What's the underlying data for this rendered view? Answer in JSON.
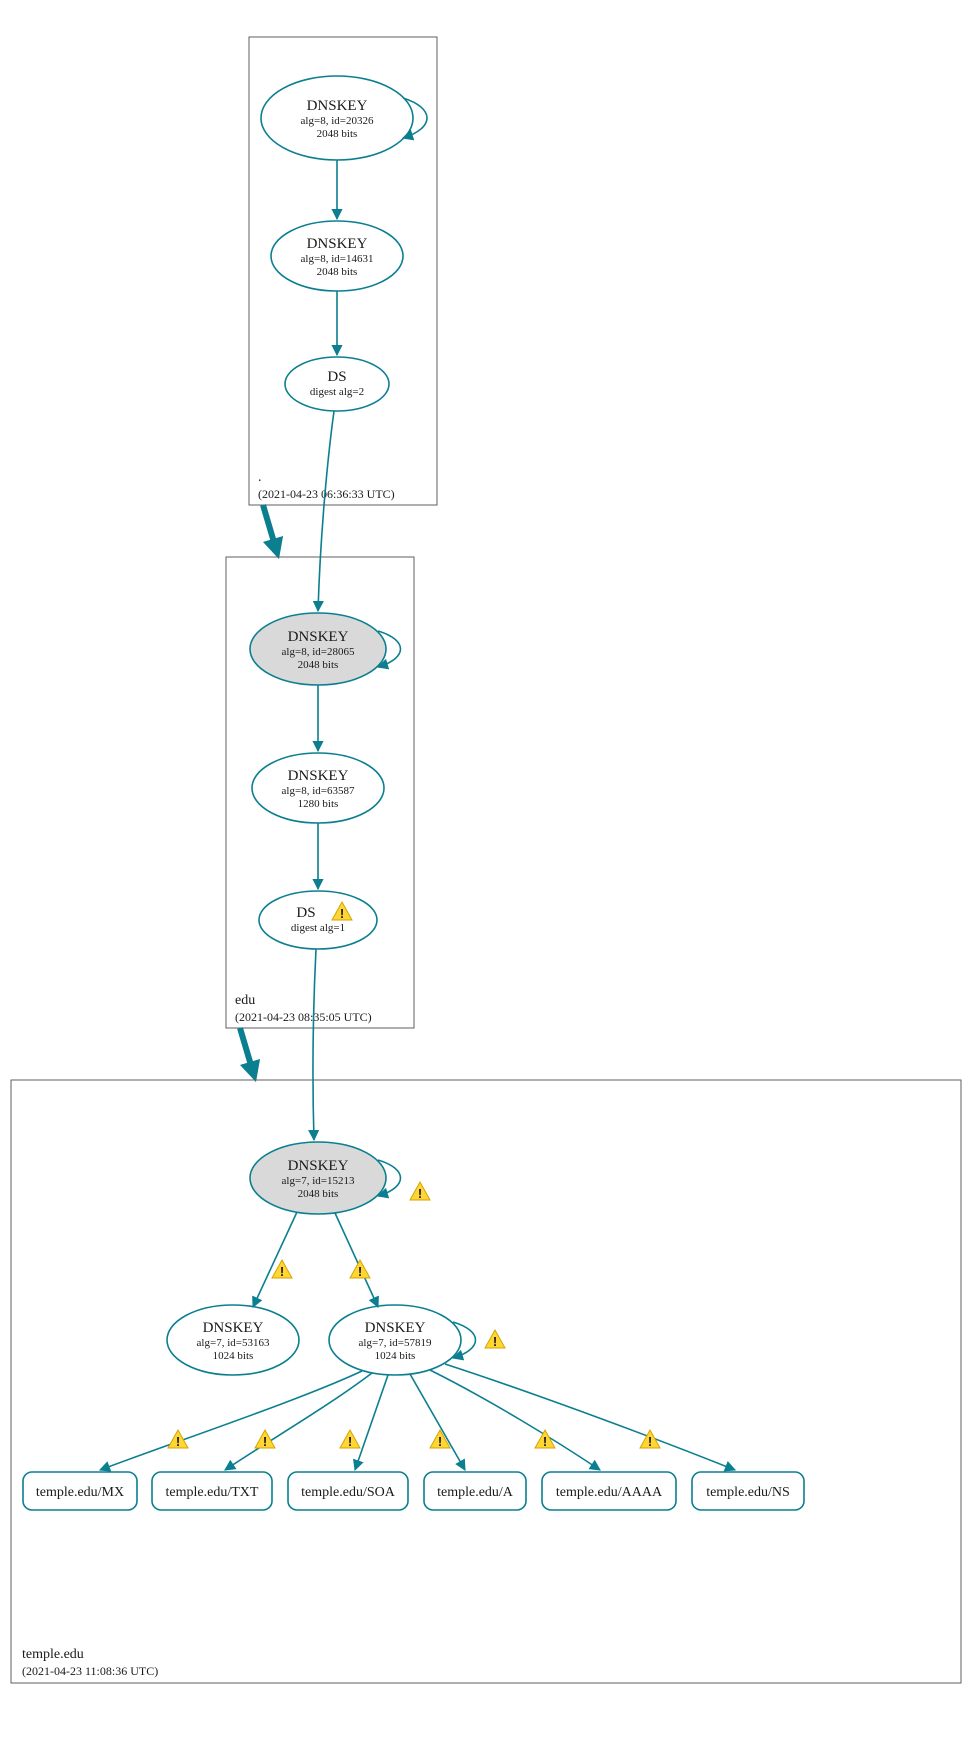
{
  "zones": {
    "root": {
      "name": ".",
      "timestamp": "(2021-04-23 06:36:33 UTC)"
    },
    "edu": {
      "name": "edu",
      "timestamp": "(2021-04-23 08:35:05 UTC)"
    },
    "temple": {
      "name": "temple.edu",
      "timestamp": "(2021-04-23 11:08:36 UTC)"
    }
  },
  "nodes": {
    "root_ksk": {
      "title": "DNSKEY",
      "line2": "alg=8, id=20326",
      "line3": "2048 bits"
    },
    "root_zsk": {
      "title": "DNSKEY",
      "line2": "alg=8, id=14631",
      "line3": "2048 bits"
    },
    "root_ds": {
      "title": "DS",
      "line2": "digest alg=2"
    },
    "edu_ksk": {
      "title": "DNSKEY",
      "line2": "alg=8, id=28065",
      "line3": "2048 bits"
    },
    "edu_zsk": {
      "title": "DNSKEY",
      "line2": "alg=8, id=63587",
      "line3": "1280 bits"
    },
    "edu_ds": {
      "title": "DS",
      "line2": "digest alg=1"
    },
    "temple_ksk": {
      "title": "DNSKEY",
      "line2": "alg=7, id=15213",
      "line3": "2048 bits"
    },
    "temple_z1": {
      "title": "DNSKEY",
      "line2": "alg=7, id=53163",
      "line3": "1024 bits"
    },
    "temple_z2": {
      "title": "DNSKEY",
      "line2": "alg=7, id=57819",
      "line3": "1024 bits"
    }
  },
  "records": {
    "mx": "temple.edu/MX",
    "txt": "temple.edu/TXT",
    "soa": "temple.edu/SOA",
    "a": "temple.edu/A",
    "aaaa": "temple.edu/AAAA",
    "ns": "temple.edu/NS"
  }
}
